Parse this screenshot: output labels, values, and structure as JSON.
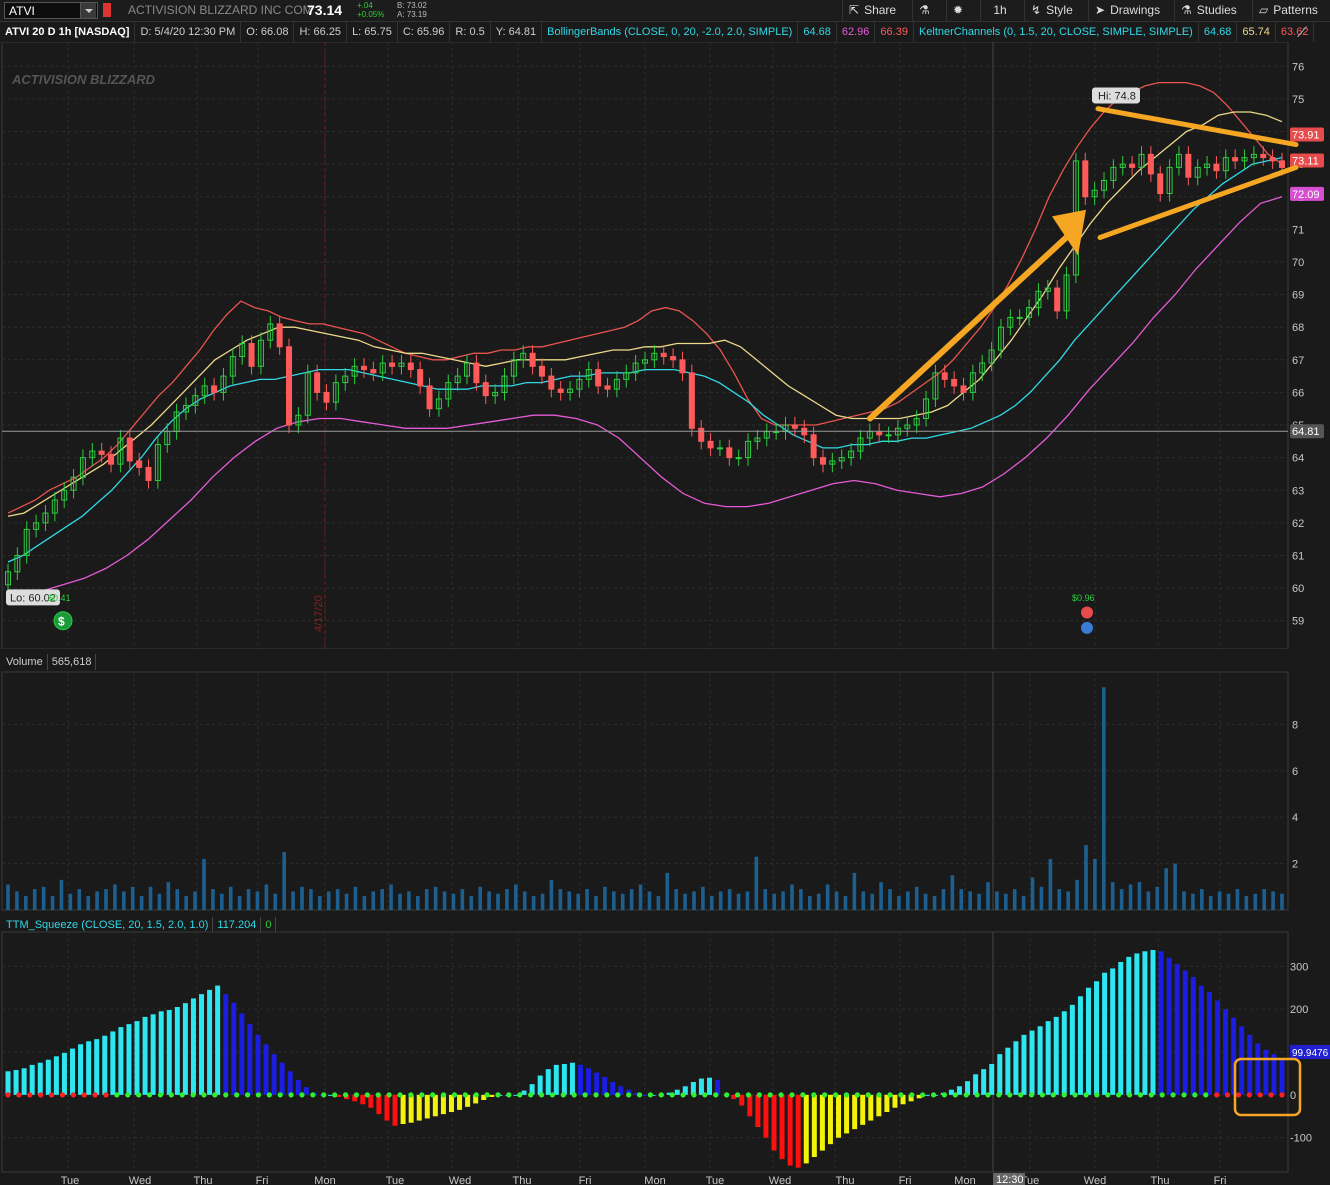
{
  "toolbar": {
    "symbol": "ATVI",
    "company": "ACTIVISION BLIZZARD INC COM",
    "last_price": "73.14",
    "change": "+.04",
    "change_pct": "+0.05%",
    "bid": "B: 73.02",
    "ask": "A: 73.19",
    "share_label": "Share",
    "timeframe_label": "1h",
    "style_label": "Style",
    "drawings_label": "Drawings",
    "studies_label": "Studies",
    "patterns_label": "Patterns"
  },
  "study_header": {
    "chart_title": "ATVI 20 D 1h [NASDAQ]",
    "date": "D: 5/4/20 12:30 PM",
    "open": "O: 66.08",
    "high": "H: 66.25",
    "low": "L: 65.75",
    "close": "C: 65.96",
    "range": "R: 0.5",
    "y": "Y: 64.81",
    "bollinger_name": "BollingerBands (CLOSE, 0, 20, -2.0, 2.0, SIMPLE)",
    "bollinger_v1": "64.68",
    "bollinger_v2": "62.96",
    "bollinger_v3": "66.39",
    "keltner_name": "KeltnerChannels (0, 1.5, 20, CLOSE, SIMPLE, SIMPLE)",
    "keltner_v1": "64.68",
    "keltner_v2": "65.74",
    "keltner_v3": "63.62"
  },
  "volume_header": {
    "label": "Volume",
    "value": "565,618"
  },
  "ttm_header": {
    "label": "TTM_Squeeze (CLOSE, 20, 1.5, 2.0, 1.0)",
    "value": "117.204",
    "value2": "0"
  },
  "logo_text": "ACTIVISION BLIZZARD",
  "annotations": {
    "hi_label": "Hi: 74.8",
    "lo_label": "Lo: 60.02",
    "div_label": "$0.41",
    "div_label_2": "$0.96",
    "date_marker": "4/17/20",
    "crosshair_value": "64.81",
    "time_marker": "12:30",
    "badge_73_91": "73.91",
    "badge_73_11": "73.11",
    "badge_72_09": "72.09",
    "badge_ttm": "99.9476"
  },
  "colors": {
    "up": "#2ecc40",
    "down": "#ff5a5a",
    "bb_upper": "#e8554e",
    "keltner": "#ecd98a",
    "midline": "#31d8e6",
    "lower": "#e55bd6",
    "arrow": "#f5a623",
    "vol_bar": "#1d5f8f",
    "mom_cyan": "#2ee6f0",
    "mom_blue": "#1a1ee0",
    "mom_red": "#ff1010",
    "mom_yellow": "#f2f20a"
  },
  "chart_data": [
    {
      "type": "candlestick",
      "title": "ATVI 20 D 1h [NASDAQ]",
      "ylim": [
        58.5,
        76.5
      ],
      "yticks": [
        59,
        60,
        61,
        62,
        63,
        64,
        65,
        66,
        67,
        68,
        69,
        70,
        71,
        72,
        73,
        74,
        75,
        76
      ],
      "xlabels": [
        "Tue",
        "Wed",
        "Thu",
        "Fri",
        "Mon",
        "Tue",
        "Wed",
        "Thu",
        "Fri",
        "Mon",
        "Tue",
        "Wed",
        "Thu",
        "Fri",
        "Mon",
        "Tue",
        "Wed",
        "Thu",
        "Fri"
      ],
      "close": [
        60.5,
        61.0,
        61.8,
        62.0,
        62.3,
        62.7,
        63.0,
        63.4,
        64.0,
        64.2,
        64.1,
        63.8,
        64.6,
        63.9,
        63.7,
        63.3,
        64.4,
        64.8,
        65.4,
        65.6,
        65.9,
        66.2,
        66.0,
        66.5,
        67.1,
        67.5,
        66.8,
        67.6,
        68.1,
        67.4,
        65.0,
        65.3,
        66.6,
        66.0,
        65.7,
        66.3,
        66.5,
        66.8,
        66.7,
        66.6,
        66.9,
        66.8,
        66.9,
        66.7,
        66.2,
        65.5,
        65.8,
        66.3,
        66.5,
        66.9,
        66.3,
        65.9,
        66.0,
        66.5,
        67.0,
        67.2,
        66.8,
        66.5,
        66.1,
        66.0,
        66.1,
        66.4,
        66.7,
        66.2,
        66.1,
        66.4,
        66.6,
        66.9,
        67.0,
        67.2,
        67.1,
        67.0,
        66.6,
        64.9,
        64.5,
        64.3,
        64.3,
        64.0,
        64.0,
        64.5,
        64.6,
        64.8,
        64.8,
        65.0,
        64.9,
        64.7,
        64.0,
        63.8,
        63.9,
        64.0,
        64.2,
        64.6,
        64.8,
        64.7,
        64.7,
        64.9,
        65.0,
        65.2,
        65.8,
        66.6,
        66.4,
        66.2,
        66.0,
        66.6,
        66.9,
        67.3,
        68.0,
        68.3,
        68.3,
        68.6,
        69.1,
        69.2,
        68.5,
        69.6,
        73.1,
        72.0,
        72.2,
        72.5,
        72.9,
        73.0,
        72.9,
        73.3,
        72.7,
        72.1,
        72.9,
        73.3,
        72.6,
        72.9,
        73.0,
        72.8,
        73.2,
        73.1,
        73.2,
        73.3,
        73.2,
        73.1,
        72.9
      ],
      "bb_upper": [
        62.3,
        62.5,
        62.7,
        63.0,
        63.2,
        63.4,
        63.7,
        64.0,
        64.4,
        64.9,
        65.4,
        65.9,
        66.3,
        66.8,
        67.3,
        67.9,
        68.4,
        68.8,
        68.6,
        68.5,
        68.3,
        68.2,
        68.1,
        68.1,
        68.0,
        67.9,
        67.8,
        67.6,
        67.4,
        67.2,
        67.1,
        67.0,
        67.0,
        67.1,
        67.2,
        67.2,
        67.3,
        67.3,
        67.4,
        67.4,
        67.5,
        67.6,
        67.7,
        67.8,
        67.9,
        68.0,
        68.2,
        68.5,
        68.6,
        68.5,
        68.2,
        67.8,
        67.3,
        66.6,
        65.8,
        65.2,
        65.0,
        65.0,
        65.0,
        65.0,
        65.1,
        65.2,
        65.3,
        65.4,
        65.5,
        65.7,
        66.0,
        66.3,
        66.6,
        67.0,
        67.5,
        68.0,
        68.6,
        69.3,
        70.1,
        71.0,
        72.0,
        72.8,
        73.5,
        74.1,
        74.6,
        75.0,
        75.2,
        75.4,
        75.5,
        75.5,
        75.5,
        75.4,
        75.2,
        74.8,
        74.3,
        73.8,
        73.3,
        73.0
      ],
      "keltner_upper": [
        62.2,
        62.3,
        62.6,
        62.9,
        63.2,
        63.5,
        63.8,
        64.2,
        64.6,
        65.0,
        65.5,
        66.0,
        66.5,
        67.0,
        67.3,
        67.6,
        67.8,
        68.0,
        68.0,
        67.9,
        67.8,
        67.7,
        67.6,
        67.4,
        67.3,
        67.2,
        67.2,
        67.1,
        67.0,
        66.9,
        66.8,
        66.9,
        67.0,
        67.0,
        67.0,
        67.0,
        67.1,
        67.2,
        67.3,
        67.3,
        67.4,
        67.4,
        67.5,
        67.5,
        67.5,
        67.6,
        67.4,
        67.0,
        66.6,
        66.2,
        65.9,
        65.6,
        65.3,
        65.2,
        65.2,
        65.2,
        65.2,
        65.3,
        65.4,
        65.6,
        66.0,
        66.4,
        67.0,
        67.6,
        68.3,
        69.0,
        69.8,
        70.5,
        71.2,
        71.8,
        72.3,
        72.8,
        73.2,
        73.6,
        74.0,
        74.2,
        74.5,
        74.6,
        74.6,
        74.5,
        74.3
      ],
      "midline": [
        60.8,
        61.0,
        61.3,
        61.6,
        61.9,
        62.2,
        62.6,
        63.0,
        63.5,
        64.0,
        64.6,
        65.1,
        65.5,
        65.8,
        66.0,
        66.2,
        66.3,
        66.4,
        66.4,
        66.5,
        66.6,
        66.7,
        66.7,
        66.7,
        66.6,
        66.5,
        66.4,
        66.3,
        66.2,
        66.1,
        66.1,
        66.1,
        66.2,
        66.2,
        66.2,
        66.3,
        66.3,
        66.4,
        66.5,
        66.5,
        66.6,
        66.6,
        66.6,
        66.7,
        66.7,
        66.7,
        66.6,
        66.5,
        66.3,
        66.0,
        65.7,
        65.3,
        65.0,
        64.7,
        64.5,
        64.3,
        64.3,
        64.4,
        64.4,
        64.5,
        64.5,
        64.6,
        64.6,
        64.7,
        64.8,
        64.9,
        65.1,
        65.3,
        65.6,
        66.0,
        66.5,
        67.0,
        67.6,
        68.1,
        68.6,
        69.1,
        69.6,
        70.1,
        70.6,
        71.1,
        71.6,
        72.0,
        72.4,
        72.7,
        73.0,
        73.1,
        73.2
      ],
      "bb_lower": [
        59.8,
        59.9,
        60.1,
        60.3,
        60.6,
        61.0,
        61.5,
        62.1,
        62.7,
        63.4,
        64.0,
        64.5,
        64.9,
        65.1,
        65.2,
        65.2,
        65.1,
        65.0,
        64.9,
        64.9,
        64.9,
        65.0,
        65.1,
        65.2,
        65.3,
        65.3,
        65.2,
        65.0,
        64.6,
        64.0,
        63.4,
        62.9,
        62.6,
        62.5,
        62.5,
        62.6,
        62.8,
        63.0,
        63.2,
        63.3,
        63.2,
        63.0,
        62.9,
        62.8,
        62.9,
        63.1,
        63.5,
        64.0,
        64.6,
        65.3,
        66.1,
        66.8,
        67.5,
        68.3,
        69.0,
        69.8,
        70.5,
        71.2,
        71.8,
        72.0
      ],
      "volume_ylim": [
        0,
        10
      ],
      "volume_yticks": [
        2,
        4,
        6,
        8
      ],
      "volume_hundred_thousands": [
        1.1,
        0.8,
        0.6,
        0.9,
        1.0,
        0.6,
        1.3,
        0.7,
        0.9,
        0.6,
        0.8,
        0.9,
        1.1,
        0.8,
        1.0,
        0.6,
        1.0,
        0.7,
        1.2,
        0.9,
        0.6,
        0.8,
        2.2,
        0.9,
        0.7,
        1.0,
        0.6,
        0.9,
        0.8,
        1.1,
        0.7,
        2.5,
        0.8,
        1.0,
        0.9,
        0.6,
        0.8,
        0.9,
        0.7,
        1.0,
        0.6,
        0.8,
        0.9,
        1.1,
        0.7,
        0.8,
        0.6,
        0.9,
        1.0,
        0.8,
        0.7,
        0.9,
        0.6,
        1.0,
        0.8,
        0.7,
        0.9,
        1.1,
        0.8,
        0.6,
        0.7,
        1.3,
        0.9,
        0.8,
        0.7,
        0.9,
        0.6,
        1.0,
        0.8,
        0.7,
        0.9,
        1.1,
        0.8,
        0.6,
        1.6,
        0.9,
        0.7,
        0.8,
        1.0,
        0.6,
        0.8,
        0.9,
        0.7,
        0.8,
        2.3,
        0.9,
        0.7,
        0.8,
        1.1,
        0.9,
        0.6,
        0.7,
        1.1,
        0.8,
        0.6,
        1.6,
        0.8,
        0.7,
        1.2,
        0.9,
        0.6,
        0.8,
        1.0,
        0.7,
        0.6,
        0.9,
        1.5,
        0.9,
        0.8,
        0.7,
        1.2,
        0.8,
        0.7,
        0.9,
        0.6,
        1.4,
        1.0,
        2.2,
        0.9,
        0.8,
        1.3,
        2.8,
        2.2,
        9.6,
        1.2,
        0.9,
        1.1,
        1.2,
        0.8,
        1.0,
        1.8,
        2.0,
        0.8,
        0.7,
        0.9,
        0.6,
        0.8,
        0.7,
        0.9,
        0.6,
        0.7,
        0.9,
        0.8,
        0.7
      ],
      "ttm_ylim": [
        -180,
        380
      ],
      "ttm_yticks": [
        -100,
        0,
        100,
        200,
        300
      ],
      "ttm_momentum": [
        55,
        58,
        62,
        70,
        75,
        82,
        90,
        98,
        108,
        118,
        125,
        130,
        138,
        148,
        158,
        165,
        172,
        182,
        188,
        195,
        198,
        205,
        214,
        225,
        235,
        245,
        255,
        235,
        215,
        190,
        165,
        140,
        118,
        95,
        75,
        55,
        35,
        18,
        5,
        0,
        0,
        -5,
        -10,
        -15,
        -22,
        -30,
        -45,
        -60,
        -72,
        -68,
        -65,
        -60,
        -55,
        -50,
        -45,
        -40,
        -35,
        -28,
        -20,
        -12,
        -5,
        0,
        0,
        0,
        10,
        25,
        45,
        60,
        70,
        72,
        75,
        70,
        62,
        52,
        42,
        30,
        20,
        12,
        5,
        0,
        0,
        0,
        5,
        12,
        20,
        30,
        38,
        40,
        35,
        0,
        -10,
        -25,
        -50,
        -75,
        -100,
        -130,
        -150,
        -165,
        -170,
        -160,
        -145,
        -130,
        -115,
        -100,
        -90,
        -80,
        -70,
        -60,
        -50,
        -40,
        -30,
        -22,
        -15,
        -8,
        0,
        0,
        5,
        12,
        20,
        32,
        48,
        60,
        72,
        95,
        110,
        125,
        140,
        150,
        160,
        172,
        182,
        195,
        210,
        230,
        250,
        265,
        285,
        295,
        310,
        322,
        330,
        335,
        338,
        335,
        320,
        305,
        290,
        275,
        255,
        240,
        220,
        200,
        180,
        160,
        140,
        120,
        105,
        95,
        85
      ],
      "ttm_squeeze_dots": "red = squeeze on, green = squeeze off"
    }
  ]
}
